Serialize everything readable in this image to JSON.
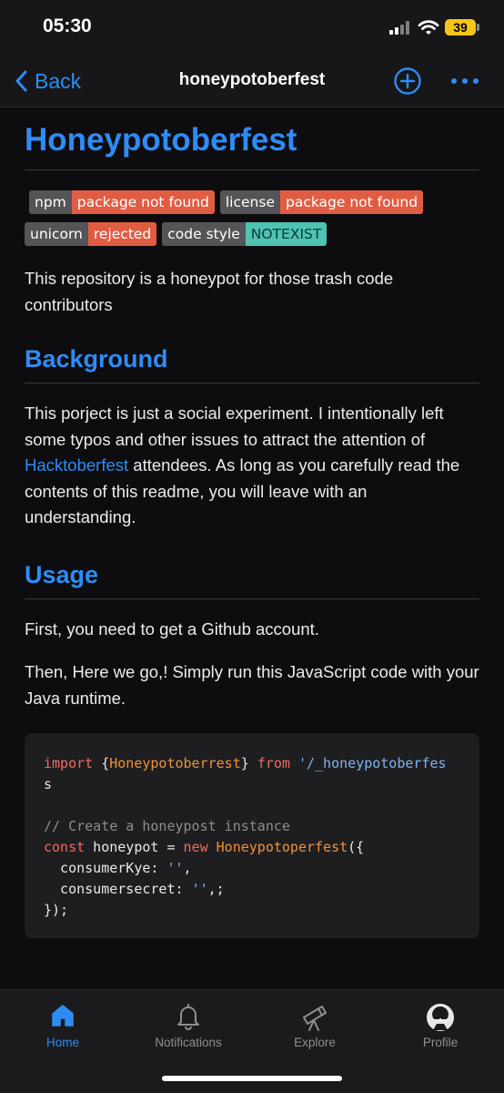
{
  "status_bar": {
    "time": "05:30",
    "battery": "39"
  },
  "nav": {
    "back_label": "Back",
    "title": "honeypotoberfest"
  },
  "readme": {
    "title": "Honeypotoberfest",
    "badges_row1": [
      {
        "label": "npm",
        "value": "package not found",
        "color": "#e05d44"
      },
      {
        "label": "license",
        "value": "package not found",
        "color": "#e05d44"
      }
    ],
    "badges_row2": [
      {
        "label": "unicorn",
        "value": "rejected",
        "color": "#e05d44"
      },
      {
        "label": "code style",
        "value": "NOTEXIST",
        "color": "#4ec3b1"
      }
    ],
    "intro": "This repository is a honeypot for those trash code contributors",
    "background_heading": "Background",
    "background_text_1": "This porject is just a social experiment. I intentionally left some typos and other issues to attract the attention of ",
    "background_link": "Hacktoberfest",
    "background_text_2": " attendees. As long as you carefully read the contents of this readme, you will leave with an understanding.",
    "usage_heading": "Usage",
    "usage_text_1": "First, you need to get a Github account.",
    "usage_text_2": "Then, Here we go,! Simply run this JavaScript code with your Java runtime.",
    "code": {
      "line1_kw": "import",
      "line1_brace_open": " {",
      "line1_cls": "Honeypotoberrest",
      "line1_brace_close": "} ",
      "line1_from": "from",
      "line1_str": " '/_honeypotoberfes",
      "line2": "s",
      "comment": "// Create a honeypost instance",
      "const_kw": "const",
      "var_name": " honeypot = ",
      "new_kw": "new",
      "ctor": " Honeypotoperfest",
      "ctor_open": "({",
      "prop1": "  consumerKye: ",
      "prop1_val": "''",
      "prop1_end": ",",
      "prop2": "  consumersecret: ",
      "prop2_val": "''",
      "prop2_end": ",;",
      "close": "});"
    }
  },
  "tabs": [
    {
      "label": "Home",
      "icon": "home-icon",
      "active": true
    },
    {
      "label": "Notifications",
      "icon": "bell-icon",
      "active": false
    },
    {
      "label": "Explore",
      "icon": "telescope-icon",
      "active": false
    },
    {
      "label": "Profile",
      "icon": "avatar",
      "active": false
    }
  ],
  "colors": {
    "accent": "#2e8cf5",
    "badge_red": "#e05d44",
    "badge_teal": "#4ec3b1"
  }
}
